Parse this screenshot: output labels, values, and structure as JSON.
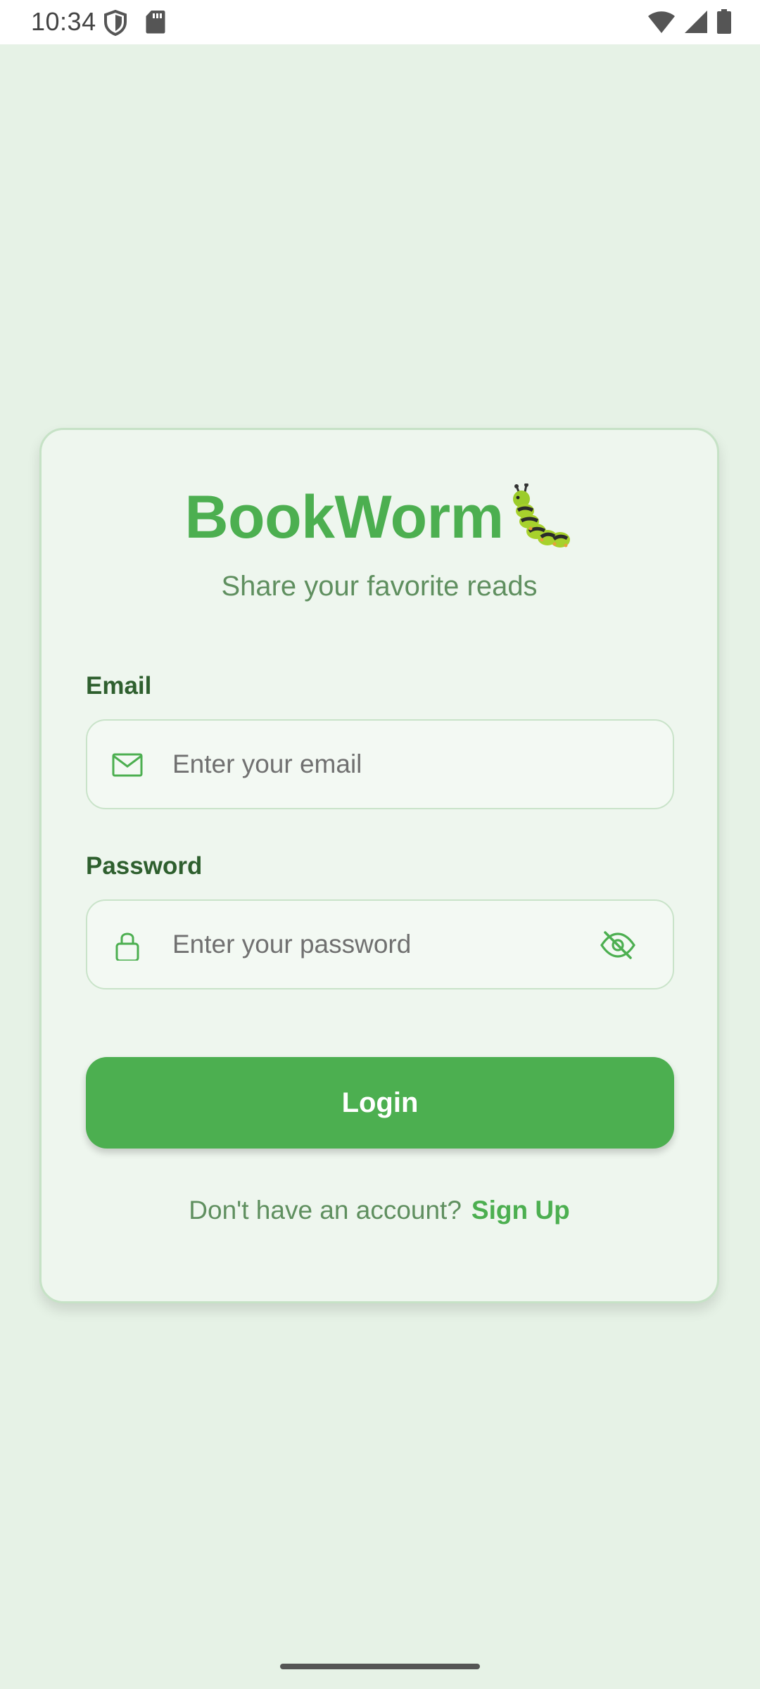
{
  "status_bar": {
    "time": "10:34",
    "icons": [
      "shield-icon",
      "sd-card-icon",
      "wifi-icon",
      "cell-signal-icon",
      "battery-icon"
    ]
  },
  "brand": {
    "title": "BookWorm",
    "emoji_icon": "caterpillar-icon",
    "subtitle": "Share your favorite reads"
  },
  "form": {
    "email_label": "Email",
    "email_placeholder": "Enter your email",
    "email_icon": "mail-icon",
    "password_label": "Password",
    "password_placeholder": "Enter your password",
    "password_icon": "lock-icon",
    "visibility_icon": "eye-off-icon",
    "login_label": "Login"
  },
  "signup": {
    "prompt": "Don't have an account?",
    "link": "Sign Up"
  },
  "colors": {
    "primary": "#4caf50",
    "background": "#e6f2e6",
    "card": "#eef6ee",
    "label": "#2e5f2e"
  }
}
